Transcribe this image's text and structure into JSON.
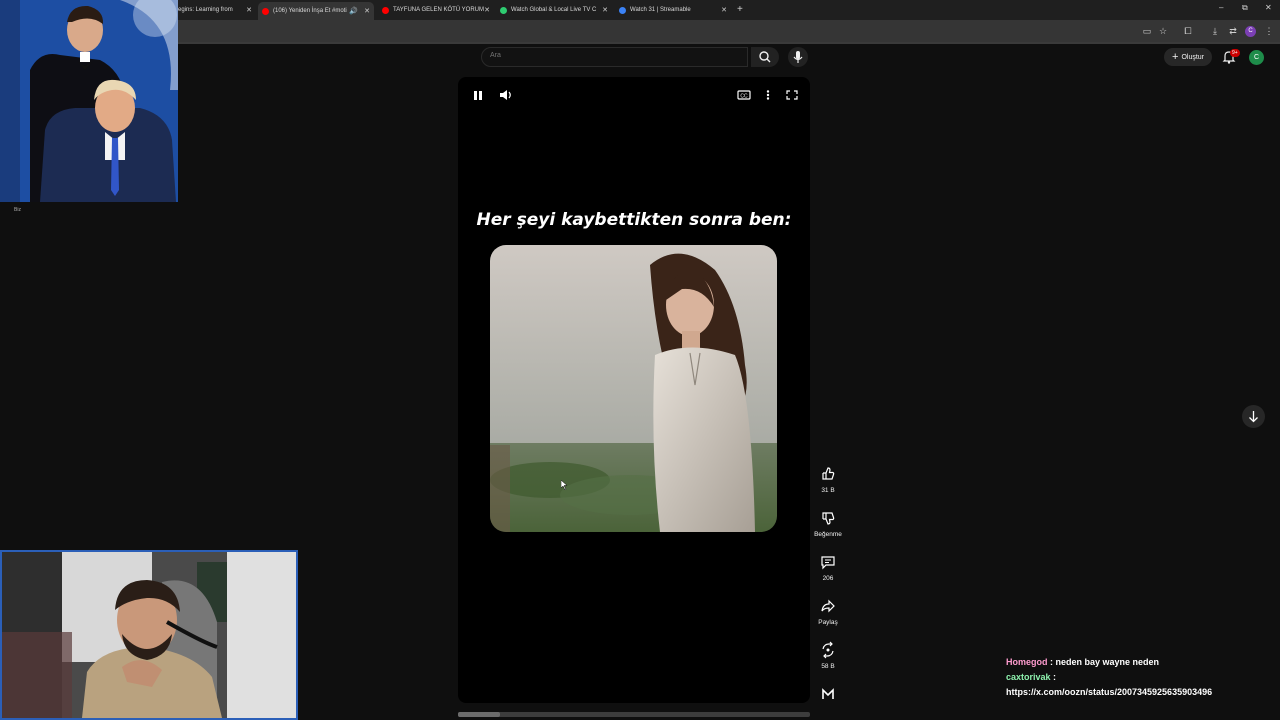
{
  "browser": {
    "tabs": [
      {
        "title": "Begins: Learning from",
        "fav": "#ffffff"
      },
      {
        "title": "(106) Yeniden İnşa Et #moti",
        "fav": "#ff0000",
        "active": true
      },
      {
        "title": "TAYFUNA GELEN KÖTÜ YORUM",
        "fav": "#ff0000"
      },
      {
        "title": "Watch Global & Local Live TV C",
        "fav": "#2ecc71"
      },
      {
        "title": "Watch 31 | Streamable",
        "fav": "#3b82f6"
      }
    ],
    "profile_initial": "C"
  },
  "youtube": {
    "search_placeholder": "Ara",
    "create_label": "Oluştur",
    "notif_count": "9+",
    "avatar_initial": "C"
  },
  "short": {
    "caption": "Her şeyi kaybettikten sonra ben:",
    "progress": 0.12,
    "actions": [
      {
        "icon": "like-icon",
        "label": "31 B"
      },
      {
        "icon": "dislike-icon",
        "label": "Beğenme"
      },
      {
        "icon": "comment-icon",
        "label": "206"
      },
      {
        "icon": "share-icon",
        "label": "Paylaş"
      },
      {
        "icon": "remix-icon",
        "label": "58 B"
      },
      {
        "icon": "channel-icon",
        "label": ""
      }
    ]
  },
  "overlay": {
    "webcam_label": "Biz",
    "chat": [
      {
        "user": "Homegod",
        "message": "neden bay wayne neden"
      },
      {
        "user": "caxtorivak",
        "message": "https://x.com/oozn/status/2007345925635903496"
      }
    ]
  }
}
